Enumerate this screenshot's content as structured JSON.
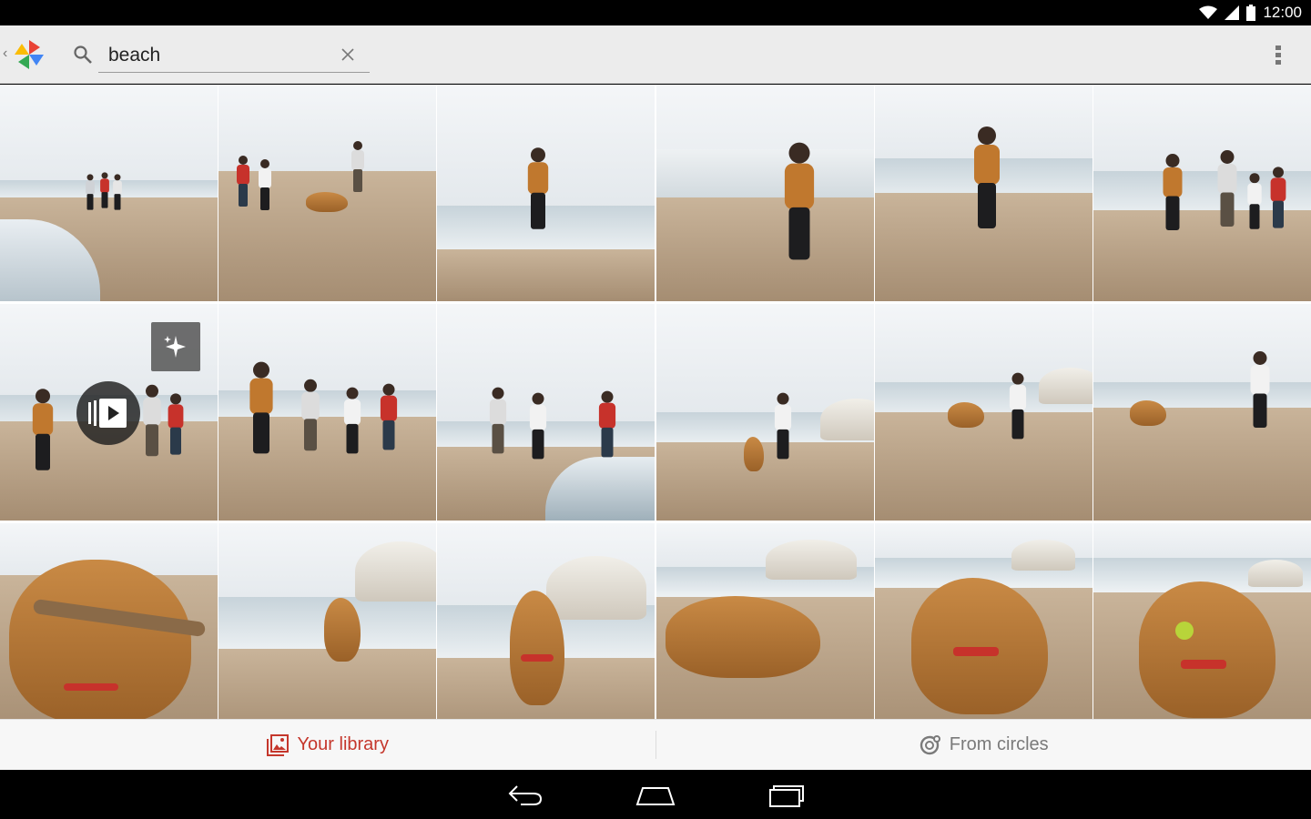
{
  "status_bar": {
    "time": "12:00"
  },
  "action_bar": {
    "search": {
      "value": "beach",
      "placeholder": ""
    }
  },
  "grid": {
    "rows": 3,
    "columns": 6,
    "photos": [
      {
        "desc": "beach-photo"
      },
      {
        "desc": "beach-photo"
      },
      {
        "desc": "beach-photo"
      },
      {
        "desc": "beach-photo"
      },
      {
        "desc": "beach-photo"
      },
      {
        "desc": "beach-photo"
      },
      {
        "desc": "auto-awesome-motion"
      },
      {
        "desc": "beach-photo"
      },
      {
        "desc": "beach-photo"
      },
      {
        "desc": "beach-photo"
      },
      {
        "desc": "beach-photo"
      },
      {
        "desc": "beach-photo"
      },
      {
        "desc": "dog-photo"
      },
      {
        "desc": "dog-photo"
      },
      {
        "desc": "dog-photo"
      },
      {
        "desc": "dog-photo"
      },
      {
        "desc": "dog-photo"
      },
      {
        "desc": "dog-photo"
      }
    ]
  },
  "tabs": {
    "library_label": "Your library",
    "circles_label": "From circles",
    "active": "library"
  },
  "colors": {
    "accent": "#c5372c",
    "inactive": "#7a7a7a",
    "action_bar": "#ececec"
  },
  "icons": {
    "app": "google-photos-pinwheel-icon",
    "search": "search-icon",
    "clear": "close-icon",
    "overflow": "overflow-menu-icon",
    "auto_awesome": "sparkle-icon",
    "motion": "motion-play-icon",
    "library": "photo-library-icon",
    "circles": "circles-icon"
  }
}
